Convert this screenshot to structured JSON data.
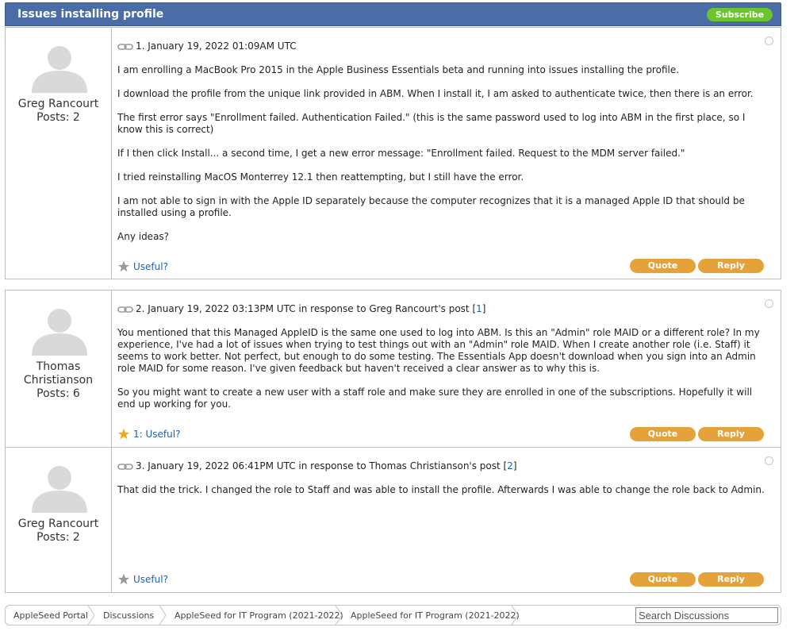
{
  "header": {
    "title": "Issues installing profile",
    "subscribe_label": "Subscribe"
  },
  "posts": [
    {
      "author": "Greg Rancourt",
      "author_line2": "",
      "posts": "Posts: 2",
      "meta": "1. January 19, 2022 01:09AM UTC",
      "response_prefix": "",
      "response_link": "",
      "response_suffix": "",
      "paragraphs": [
        "I am enrolling a MacBook Pro 2015 in the Apple Business Essentials beta and running into issues installing the profile.",
        "I download the profile from the unique link provided in ABM. When I install it, I am asked to authenticate twice, then there is an error.",
        "The first error says \"Enrollment failed. Authentication Failed.\" (this is the same password used to log into ABM in the first place, so I know this is correct)",
        "If I then click Install... a second time, I get a new error message: \"Enrollment failed. Request to the MDM server failed.\"",
        "I tried reinstalling MacOS Monterrey 12.1 then reattempting, but I still have the error.",
        "I am not able to sign in with the Apple ID separately because the computer recognizes that it is a managed Apple ID that should be installed using a profile.",
        "Any ideas?"
      ],
      "useful": "Useful?",
      "quote_label": "Quote",
      "reply_label": "Reply"
    },
    {
      "author": "Thomas",
      "author_line2": "Christianson",
      "posts": "Posts: 6",
      "meta": "2. January 19, 2022 03:13PM UTC in response to Greg Rancourt's post [",
      "response_link": "1",
      "response_suffix": "]",
      "paragraphs": [
        "You mentioned that this Managed AppleID is the same one used to log into ABM. Is this an \"Admin\" role MAID or a different role? In my experience, I've had a lot of issues when trying to test things out with an \"Admin\" role MAID. When I create another role (i.e. Staff) it seems to work better. Not perfect, but enough to do some testing. The Essentials App doesn't download when you sign into an Admin role MAID for some reason. I've given feedback but haven't received a clear answer as to why this is.",
        "So you might want to create a new user with a staff role and make sure they are enrolled in one of the subscriptions. Hopefully it will end up working for you."
      ],
      "useful": "1: Useful?",
      "quote_label": "Quote",
      "reply_label": "Reply"
    },
    {
      "author": "Greg Rancourt",
      "author_line2": "",
      "posts": "Posts: 2",
      "meta": "3. January 19, 2022 06:41PM UTC in response to Thomas Christianson's post [",
      "response_link": "2",
      "response_suffix": "]",
      "paragraphs": [
        "That did the trick. I changed the role to Staff and was able to install the profile. Afterwards I was able to change the role back to Admin."
      ],
      "useful": "Useful?",
      "quote_label": "Quote",
      "reply_label": "Reply"
    }
  ],
  "breadcrumb": [
    "AppleSeed Portal",
    "Discussions",
    "AppleSeed for IT Program (2021-2022)",
    "AppleSeed for IT Program (2021-2022)"
  ],
  "search": {
    "placeholder": "Search Discussions"
  },
  "colors": {
    "header": "#4a6da7",
    "subscribe": "#6cc52d",
    "button": "#e6a23a",
    "link": "#1a5fb4",
    "star_active": "#f0a81c",
    "star_inactive": "#9a9a9a"
  }
}
